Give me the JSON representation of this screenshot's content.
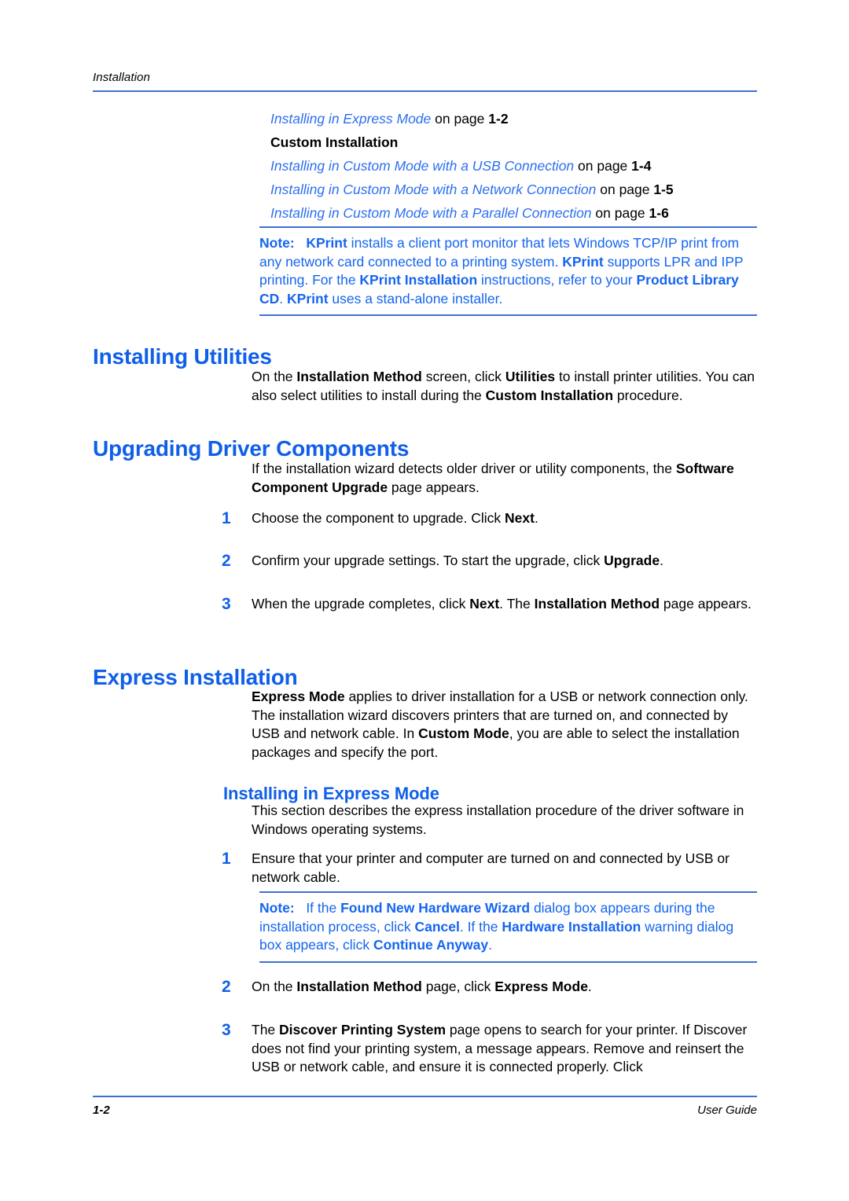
{
  "header": {
    "chapter_label": "Installation"
  },
  "xref_list": [
    {
      "link": "Installing in Express Mode",
      "tail": " on page ",
      "page": "1-2"
    }
  ],
  "custom_installation_heading": "Custom Installation",
  "xref_list_2": [
    {
      "link": "Installing in Custom Mode with a USB Connection",
      "tail": " on page ",
      "page": "1-4"
    },
    {
      "link": "Installing in Custom Mode with a Network Connection",
      "tail": " on page ",
      "page": "1-5"
    },
    {
      "link": "Installing in Custom Mode with a Parallel Connection",
      "tail": " on page ",
      "page": "1-6"
    }
  ],
  "note_1": {
    "label": "Note:",
    "text": "KPrint installs a client port monitor that lets Windows TCP/IP print from any network card connected to a printing system. KPrint supports LPR and IPP printing. For the KPrint Installation instructions, refer to your Product Library CD. KPrint uses a stand-alone installer."
  },
  "section_installing_utilities": {
    "heading": "Installing Utilities",
    "paragraph": "On the Installation Method screen, click Utilities to install printer utilities. You can also select utilities to install during the Custom Installation procedure."
  },
  "section_upgrading": {
    "heading": "Upgrading Driver Components",
    "paragraph": "If the installation wizard detects older driver or utility components, the Software Component Upgrade page appears.",
    "steps": [
      {
        "num": "1",
        "text": "Choose the component to upgrade. Click Next."
      },
      {
        "num": "2",
        "text": "Confirm your upgrade settings. To start the upgrade, click Upgrade."
      },
      {
        "num": "3",
        "text": "When the upgrade completes, click Next. The Installation Method page appears."
      }
    ]
  },
  "section_express": {
    "heading": "Express Installation",
    "paragraph": "Express Mode applies to driver installation for a USB or network connection only. The installation wizard discovers printers that are turned on, and connected by USB and network cable. In Custom Mode, you are able to select the installation packages and specify the port.",
    "subheading": "Installing in Express Mode",
    "intro": "This section describes the express installation procedure of the driver software in Windows operating systems.",
    "step_1": {
      "num": "1",
      "text": "Ensure that your printer and computer are turned on and connected by USB or network cable."
    },
    "note_2": {
      "label": "Note:",
      "text": "If the Found New Hardware Wizard dialog box appears during the installation process, click Cancel. If the Hardware Installation warning dialog box appears, click Continue Anyway."
    },
    "step_2": {
      "num": "2",
      "text": "On the Installation Method page, click Express Mode."
    },
    "step_3": {
      "num": "3",
      "text": "The Discover Printing System page opens to search for your printer. If Discover does not find your printing system, a message appears. Remove and reinsert the USB or network cable, and ensure it is connected properly. Click"
    }
  },
  "footer": {
    "page_number": "1-2",
    "guide_label": "User Guide"
  },
  "colors": {
    "heading_blue": "#0f5fe8",
    "link_blue": "#2c6ff0",
    "note_blue": "#1565f0",
    "rule_blue": "#3f72d0",
    "text_black": "#000000"
  }
}
